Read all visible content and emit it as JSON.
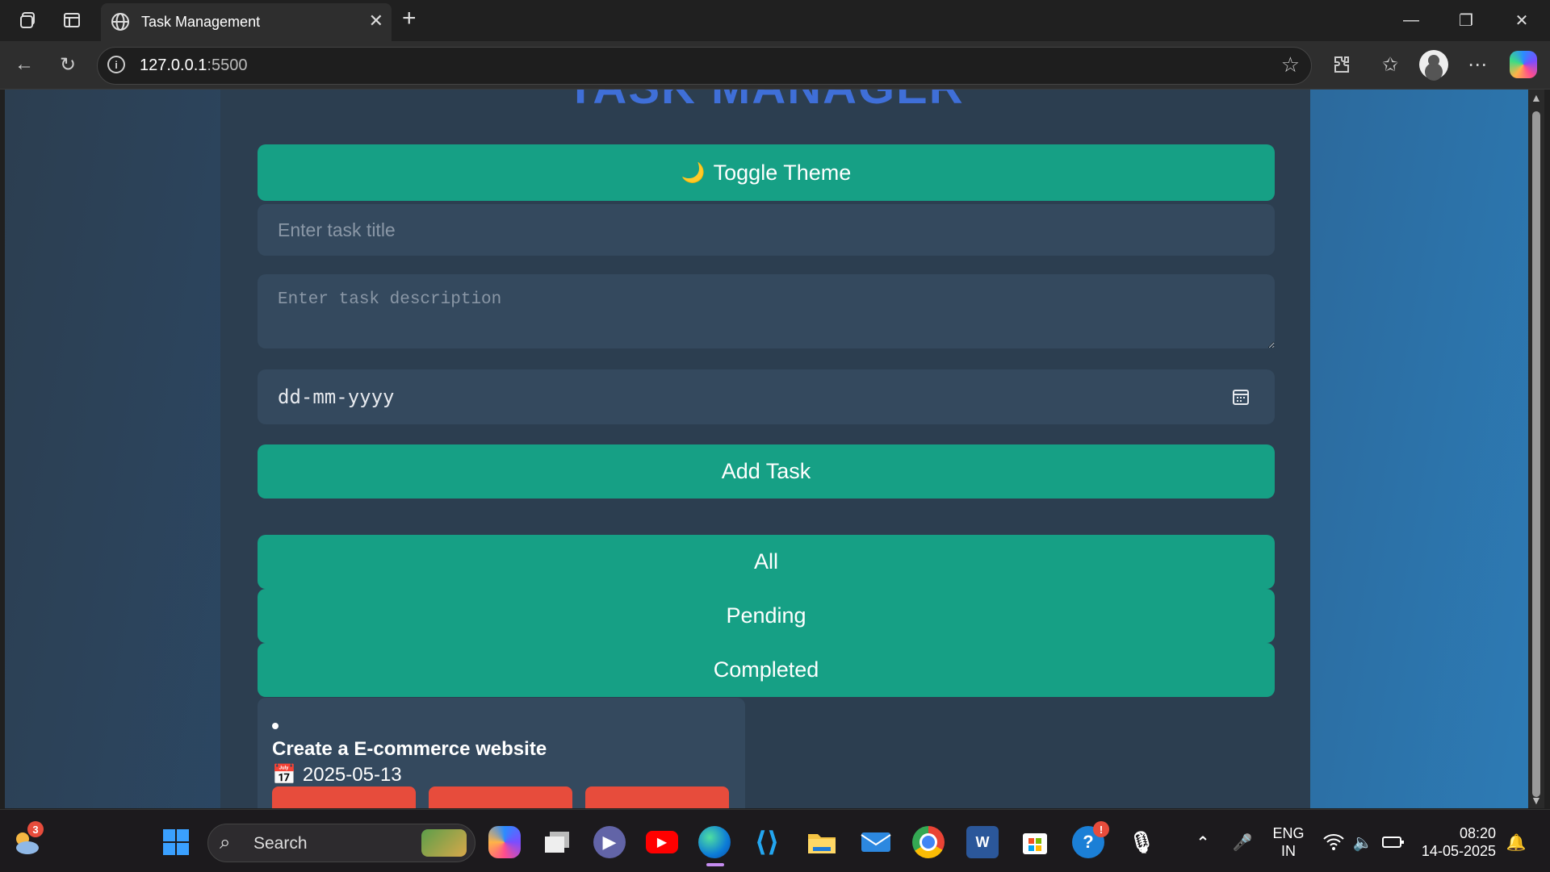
{
  "browser": {
    "tab_title": "Task Management",
    "url_host": "127.0.0.1",
    "url_port": ":5500"
  },
  "app": {
    "title": "TASK MANAGER",
    "toggle_theme_icon": "🌙",
    "toggle_theme_label": "Toggle Theme",
    "task_title_placeholder": "Enter task title",
    "task_description_placeholder": "Enter task description",
    "date_placeholder": "dd-mm-yyyy",
    "add_task_label": "Add Task",
    "filters": [
      "All",
      "Pending",
      "Completed"
    ],
    "tasks": [
      {
        "title": "Create a E-commerce website",
        "date": "2025-05-13",
        "date_icon": "📅"
      }
    ]
  },
  "taskbar": {
    "weather_badge": "3",
    "search_label": "Search",
    "language_line1": "ENG",
    "language_line2": "IN",
    "time": "08:20",
    "date": "14-05-2025"
  },
  "colors": {
    "accent_green": "#16a085",
    "container": "#2c3e50",
    "field": "#34495e",
    "title_blue": "#3f6fd8",
    "danger": "#e74c3c"
  }
}
